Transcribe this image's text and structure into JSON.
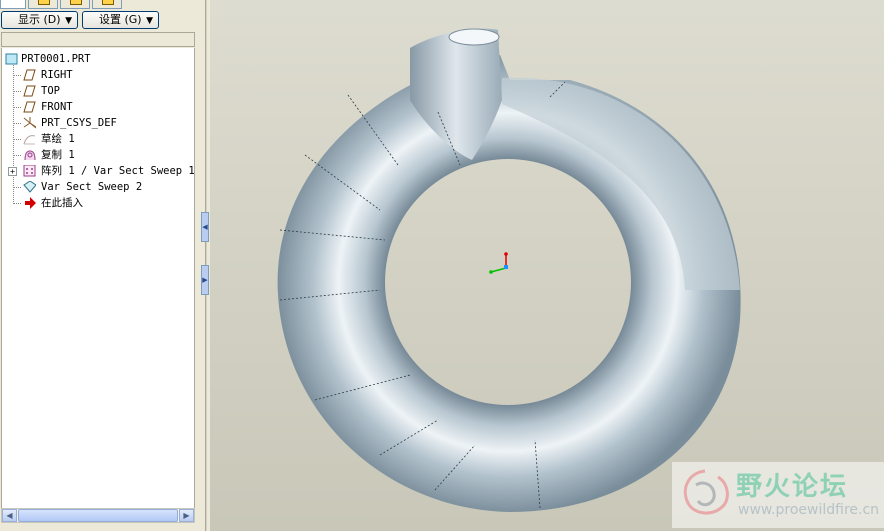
{
  "toolbar": {
    "show_label": "显示 (D)",
    "settings_label": "设置 (G)"
  },
  "tree": {
    "items": [
      {
        "label": "PRT0001.PRT",
        "icon": "part-icon"
      },
      {
        "label": "RIGHT",
        "icon": "datum-plane-icon"
      },
      {
        "label": "TOP",
        "icon": "datum-plane-icon"
      },
      {
        "label": "FRONT",
        "icon": "datum-plane-icon"
      },
      {
        "label": "PRT_CSYS_DEF",
        "icon": "coordinate-system-icon"
      },
      {
        "label": "草绘 1",
        "icon": "sketch-icon"
      },
      {
        "label": "复制 1",
        "icon": "copy-icon"
      },
      {
        "label": "阵列 1 / Var Sect Sweep 1",
        "icon": "pattern-icon"
      },
      {
        "label": "Var Sect Sweep 2",
        "icon": "sweep-icon"
      },
      {
        "label": "在此插入",
        "icon": "insert-here-icon"
      }
    ]
  },
  "watermark": {
    "title": "野火论坛",
    "url": "www.proewildfire.cn"
  },
  "colors": {
    "model": "#a9b8c3",
    "model_highlight": "#e6eef3",
    "model_shadow": "#6d7f8c",
    "background_top": "#dddcd0",
    "background_bottom": "#c8c7b8",
    "insert_arrow": "#d40000",
    "watermark_text": "#8fd1b5"
  }
}
